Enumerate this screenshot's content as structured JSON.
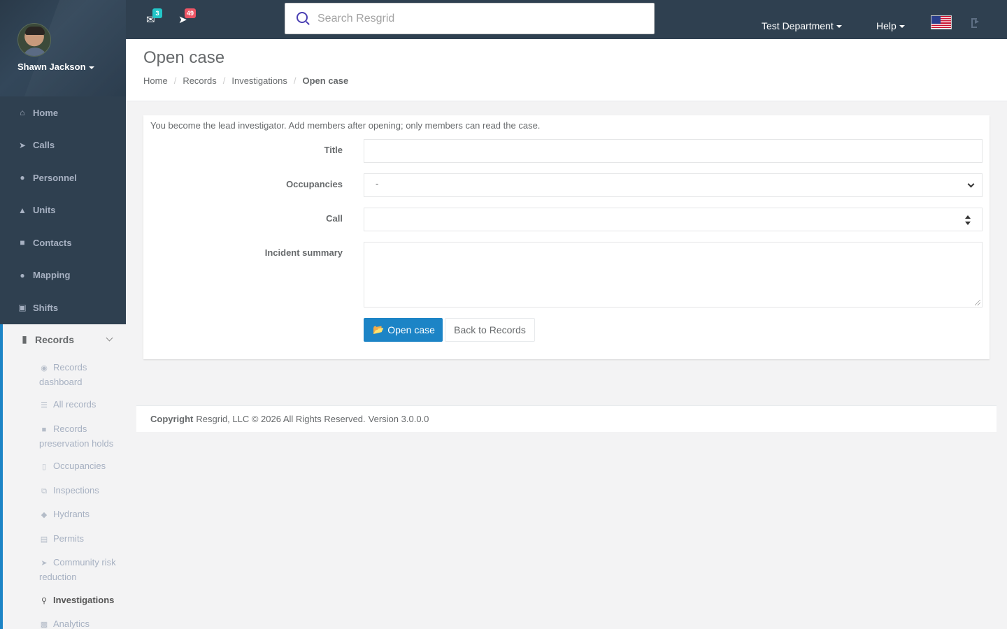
{
  "user": {
    "name": "Shawn Jackson"
  },
  "nav": {
    "items": [
      {
        "label": "Home",
        "icon": "home-icon"
      },
      {
        "label": "Calls",
        "icon": "bullhorn-icon"
      },
      {
        "label": "Personnel",
        "icon": "user-icon"
      },
      {
        "label": "Units",
        "icon": "truck-icon"
      },
      {
        "label": "Contacts",
        "icon": "address-book-icon"
      },
      {
        "label": "Mapping",
        "icon": "map-marker-icon"
      },
      {
        "label": "Shifts",
        "icon": "briefcase-icon"
      }
    ],
    "records": {
      "label": "Records",
      "sub": [
        {
          "label": "Records dashboard",
          "icon": "dashboard-icon"
        },
        {
          "label": "All records",
          "icon": "list-icon"
        },
        {
          "label": "Records preservation holds",
          "icon": "lock-icon"
        },
        {
          "label": "Occupancies",
          "icon": "building-icon"
        },
        {
          "label": "Inspections",
          "icon": "clipboard-icon"
        },
        {
          "label": "Hydrants",
          "icon": "tint-icon"
        },
        {
          "label": "Permits",
          "icon": "file-icon"
        },
        {
          "label": "Community risk reduction",
          "icon": "bullhorn-icon"
        },
        {
          "label": "Investigations",
          "icon": "search-icon"
        },
        {
          "label": "Analytics",
          "icon": "bar-chart-icon"
        }
      ]
    }
  },
  "topbar": {
    "messages_count": "3",
    "calls_count": "49",
    "search_placeholder": "Search Resgrid",
    "department": "Test Department",
    "help": "Help"
  },
  "page": {
    "title": "Open case",
    "breadcrumb": [
      "Home",
      "Records",
      "Investigations",
      "Open case"
    ]
  },
  "form": {
    "help_text": "You become the lead investigator. Add members after opening; only members can read the case.",
    "title_label": "Title",
    "title_value": "",
    "occupancies_label": "Occupancies",
    "occupancies_value": "-",
    "call_label": "Call",
    "call_value": "",
    "summary_label": "Incident summary",
    "summary_value": "",
    "open_button": "Open case",
    "back_button": "Back to Records"
  },
  "footer": {
    "copyright_label": "Copyright",
    "copyright_text": "Resgrid, LLC © 2026 All Rights Reserved.",
    "version": "Version 3.0.0.0"
  },
  "colors": {
    "sidebar_bg": "#2f4050",
    "accent": "#1c84c6",
    "badge_info": "#23c6c8",
    "badge_danger": "#ed5565"
  }
}
